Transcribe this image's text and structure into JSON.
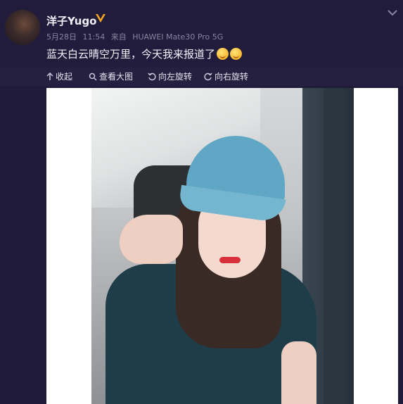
{
  "post": {
    "username": "洋子Yugo",
    "date": "5月28日",
    "time": "11:54",
    "source_prefix": "来自",
    "device": "HUAWEI Mate30 Pro 5G",
    "text": "蓝天白云晴空万里，今天我来报道了"
  },
  "toolbar": {
    "collapse_label": "收起",
    "view_large_label": "查看大图",
    "rotate_left_label": "向左旋转",
    "rotate_right_label": "向右旋转"
  },
  "icons": {
    "verified": "verified-v-badge",
    "expand": "chevron-down-icon",
    "emoji": "smiling-face-emoji"
  },
  "colors": {
    "background": "#221c3c",
    "verified": "#f5a623",
    "text": "#f2f0f8",
    "meta": "#8a859e"
  }
}
